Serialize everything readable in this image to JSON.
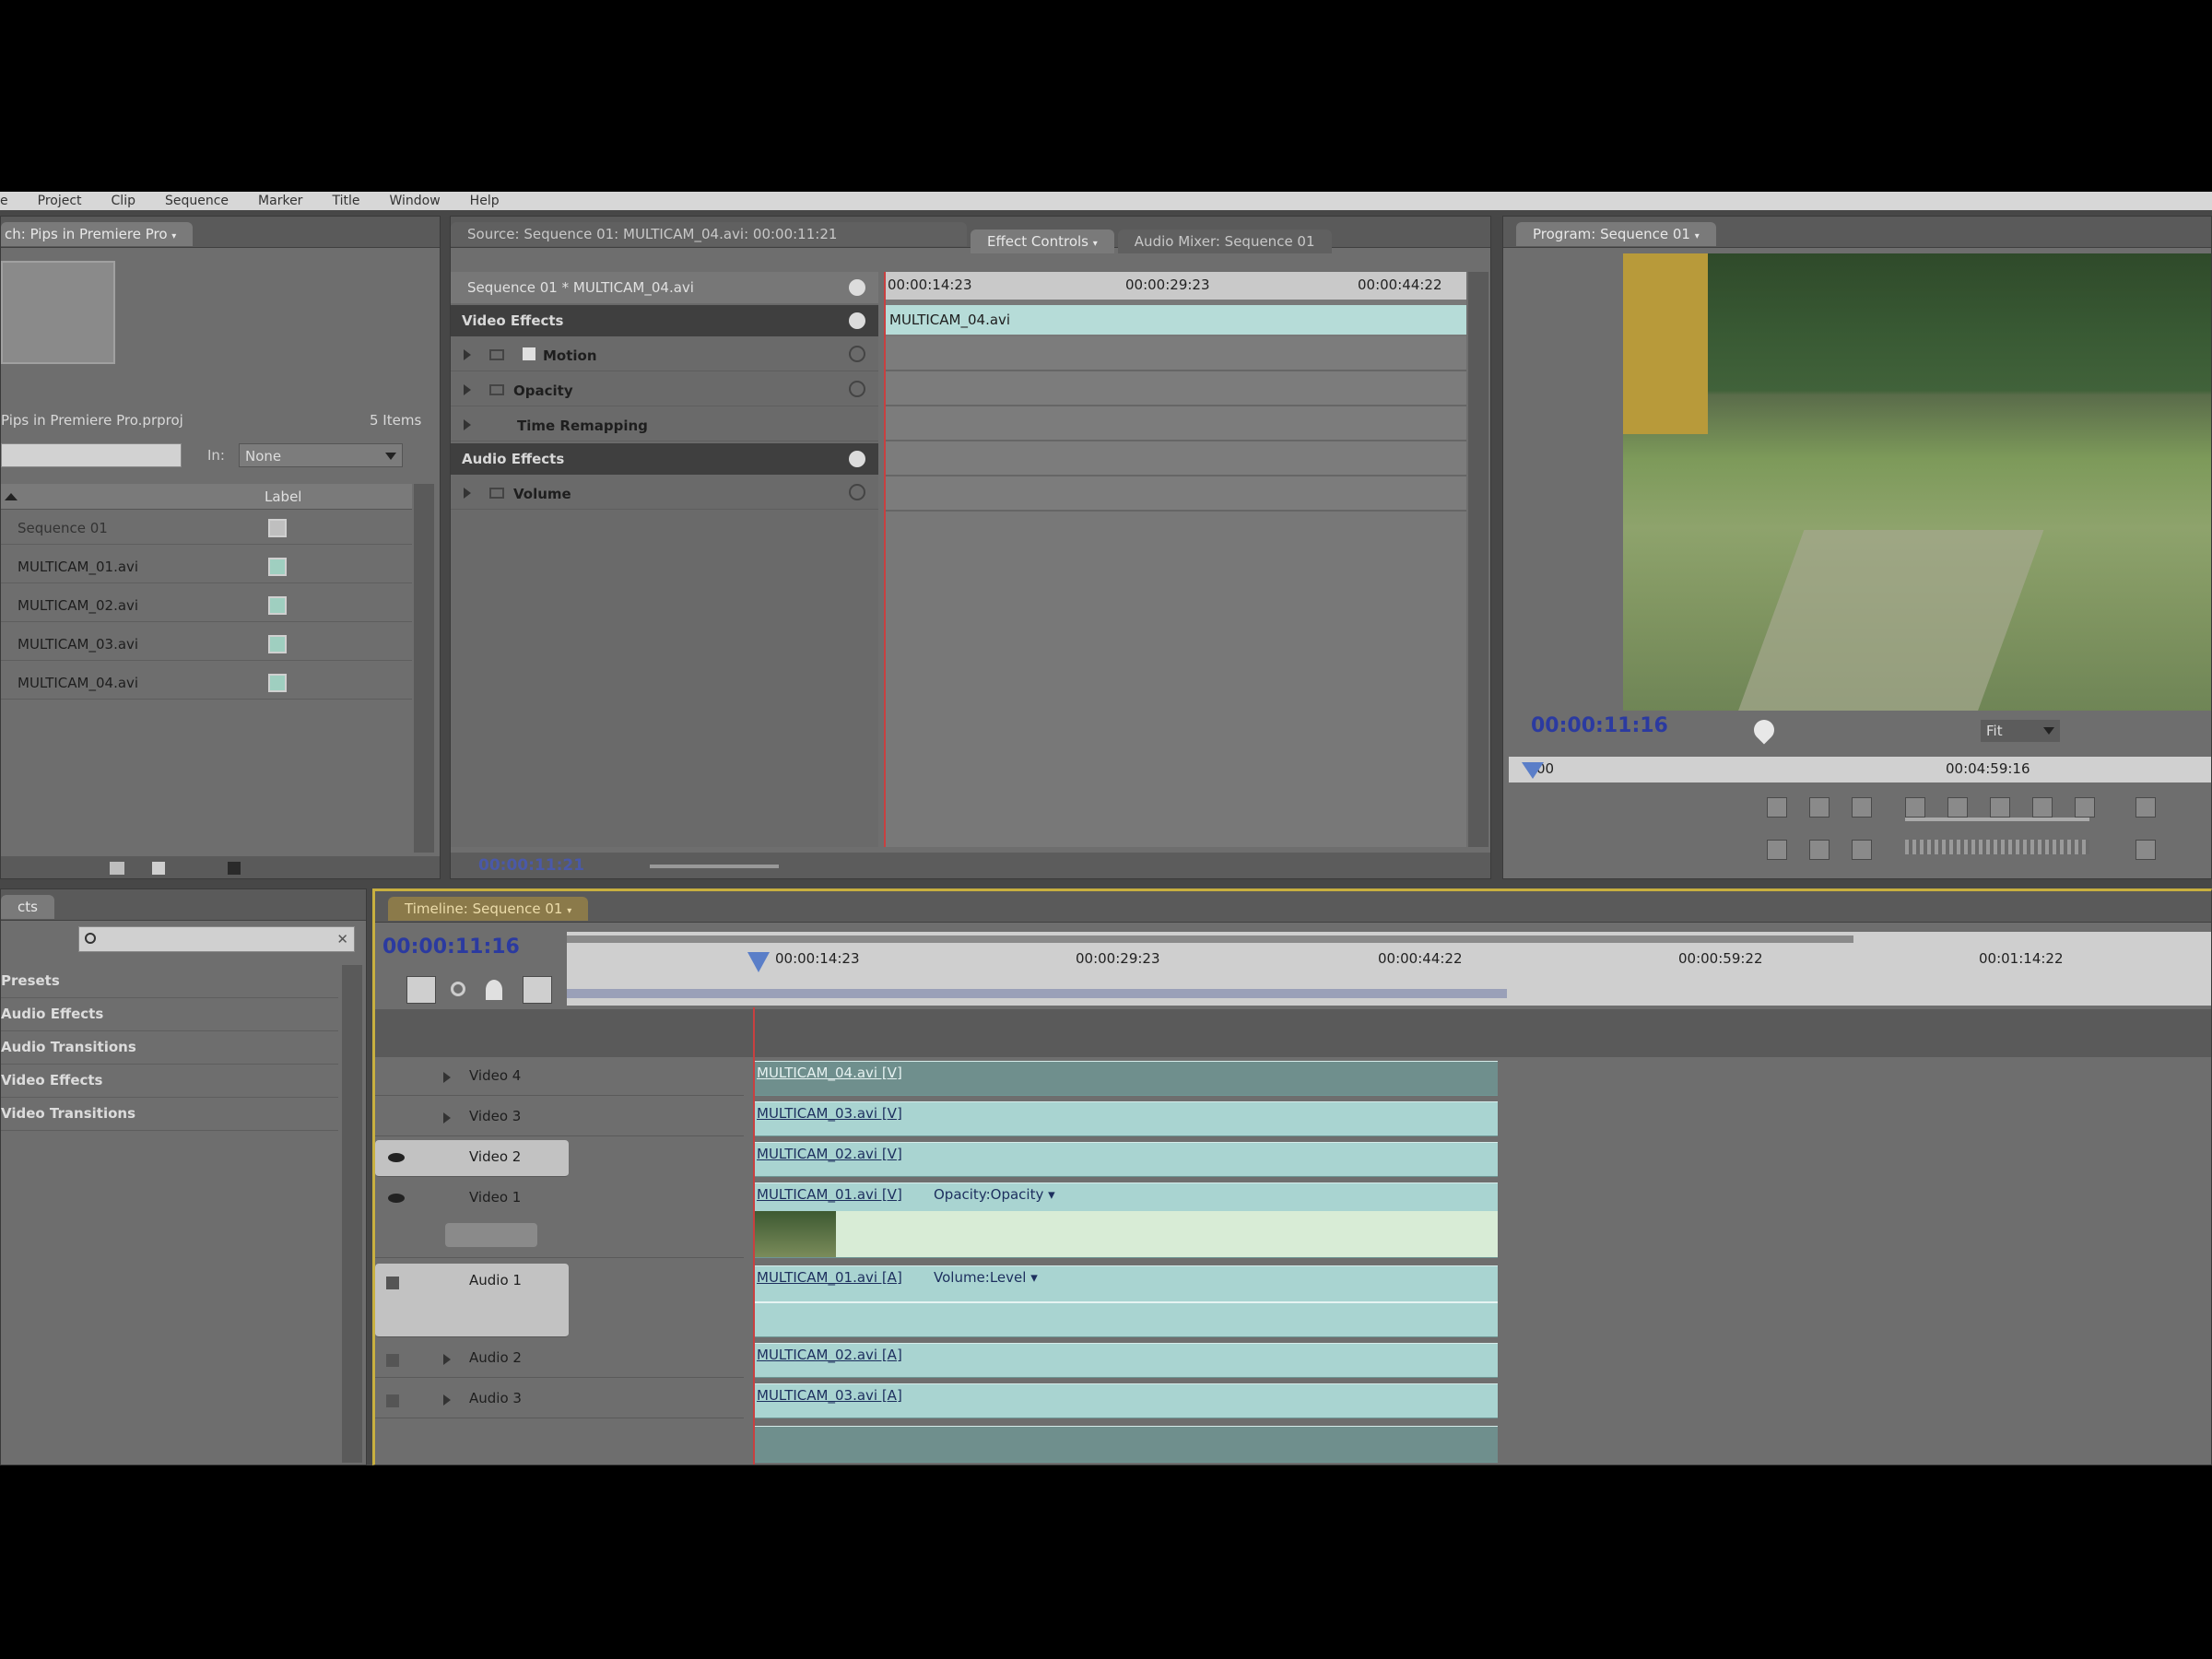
{
  "menu": [
    "e",
    "Project",
    "Clip",
    "Sequence",
    "Marker",
    "Title",
    "Window",
    "Help"
  ],
  "project_panel": {
    "title": "ch: Pips in Premiere Pro",
    "project_name": "Pips in Premiere Pro.prproj",
    "item_count": "5 Items",
    "in_label": "In:",
    "in_value": "None",
    "column_label": "Label",
    "items": [
      "Sequence 01",
      "MULTICAM_01.avi",
      "MULTICAM_02.avi",
      "MULTICAM_03.avi",
      "MULTICAM_04.avi"
    ]
  },
  "effect_controls": {
    "tabs": [
      "Source: Sequence 01: MULTICAM_04.avi: 00:00:11:21",
      "Effect Controls",
      "Audio Mixer: Sequence 01"
    ],
    "header": "Sequence 01 * MULTICAM_04.avi",
    "sections": [
      "Video Effects",
      "Audio Effects"
    ],
    "effects": [
      "Motion",
      "Opacity",
      "Time Remapping",
      "Volume"
    ],
    "ruler": [
      "00:00:14:23",
      "00:00:29:23",
      "00:00:44:22"
    ],
    "clip_name": "MULTICAM_04.avi",
    "timecode": "00:00:11:21"
  },
  "program_monitor": {
    "tab": "Program: Sequence 01",
    "timecode": "00:00:11:16",
    "fit": "Fit",
    "ruler_start": "00",
    "ruler_mid": "00:04:59:16",
    "colors": {
      "sky": "#5a6c4a",
      "grass": "#7d9a5a"
    }
  },
  "effects_panel": {
    "title": "cts",
    "search_placeholder": "",
    "bins": [
      "Presets",
      "Audio Effects",
      "Audio Transitions",
      "Video Effects",
      "Video Transitions"
    ]
  },
  "timeline": {
    "tab": "Timeline: Sequence 01",
    "timecode": "00:00:11:16",
    "ruler": [
      "00:00:14:23",
      "00:00:29:23",
      "00:00:44:22",
      "00:00:59:22",
      "00:01:14:22"
    ],
    "tracks": [
      {
        "name": "Video 4",
        "clip": "MULTICAM_04.avi [V]"
      },
      {
        "name": "Video 3",
        "clip": "MULTICAM_03.avi [V]"
      },
      {
        "name": "Video 2",
        "clip": "MULTICAM_02.avi [V]"
      },
      {
        "name": "Video 1",
        "clip": "MULTICAM_01.avi [V]",
        "fx": "Opacity:Opacity ▾"
      },
      {
        "name": "Audio 1",
        "clip": "MULTICAM_01.avi [A]",
        "fx": "Volume:Level ▾"
      },
      {
        "name": "Audio 2",
        "clip": "MULTICAM_02.avi [A]"
      },
      {
        "name": "Audio 3",
        "clip": "MULTICAM_03.avi [A]"
      }
    ],
    "colors": {
      "clip": "#a9d4d1",
      "playhead": "#c84040",
      "timecode": "#2b3aa0"
    }
  }
}
